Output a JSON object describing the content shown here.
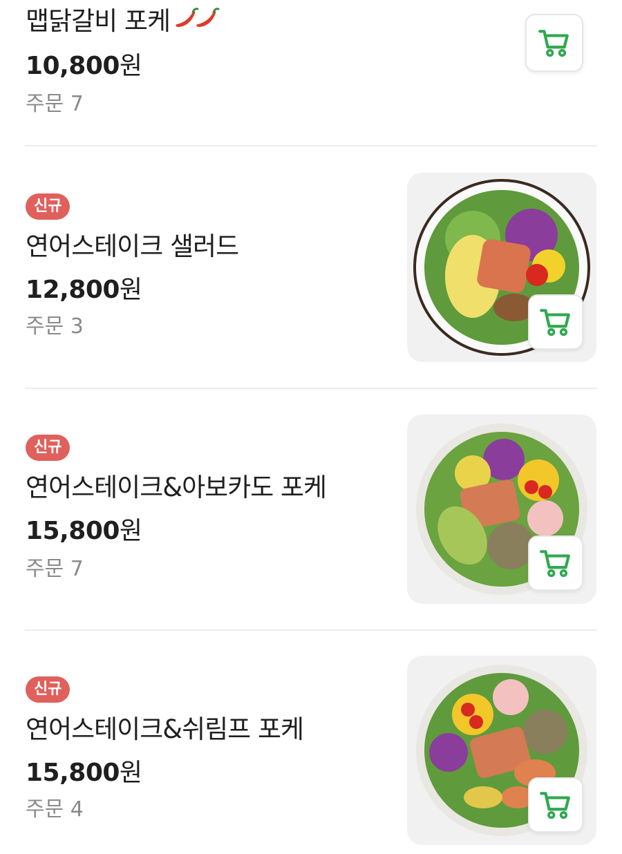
{
  "menu": {
    "cart_icon": "cart-icon",
    "accent_green": "#2fa84f",
    "badge_color": "#e0605c",
    "items": [
      {
        "name": "맵닭갈비 포케",
        "spicy_icon": "chili-pepper-icon",
        "price_number": "10,800",
        "price_unit": "원",
        "orders": "주문 7",
        "badge": ""
      },
      {
        "badge": "신규",
        "name": "연어스테이크 샐러드",
        "price_number": "12,800",
        "price_unit": "원",
        "orders": "주문 3",
        "image": "salmon-steak-salad-photo"
      },
      {
        "badge": "신규",
        "name": "연어스테이크&아보카도 포케",
        "price_number": "15,800",
        "price_unit": "원",
        "orders": "주문 7",
        "image": "salmon-avocado-poke-photo"
      },
      {
        "badge": "신규",
        "name": "연어스테이크&쉬림프 포케",
        "price_number": "15,800",
        "price_unit": "원",
        "orders": "주문 4",
        "image": "salmon-shrimp-poke-photo"
      }
    ]
  }
}
